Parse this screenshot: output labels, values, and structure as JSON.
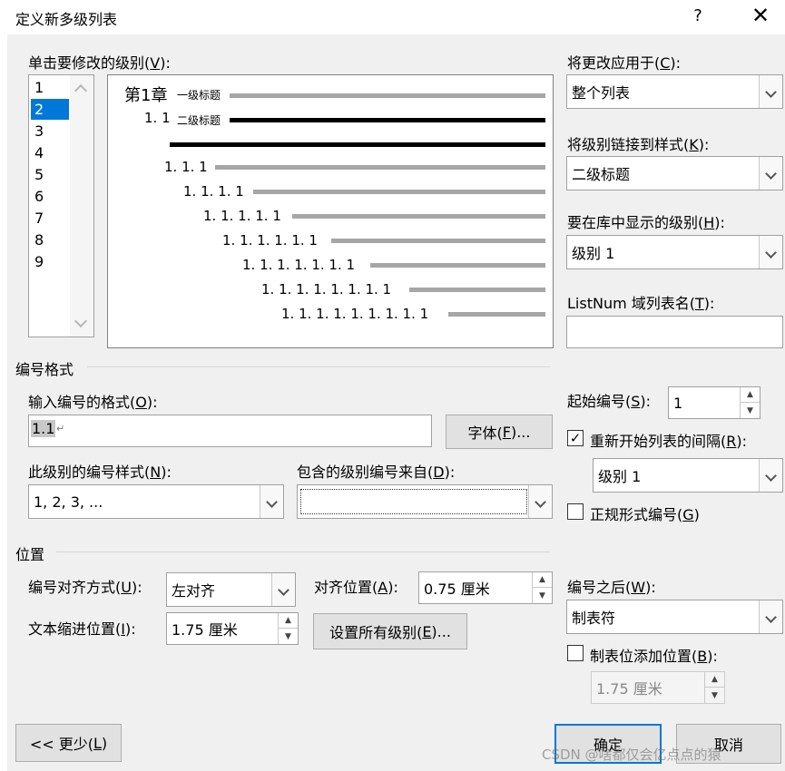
{
  "dialog": {
    "title": "定义新多级列表",
    "help_label": "?",
    "close_label": "✕"
  },
  "levels": {
    "label": "单击要修改的级别(V):",
    "items": [
      "1",
      "2",
      "3",
      "4",
      "5",
      "6",
      "7",
      "8",
      "9"
    ],
    "selected": "2"
  },
  "preview": {
    "l1_prefix": "第1章",
    "l1_title": "一级标题",
    "l2_prefix": "1. 1",
    "l2_title": "二级标题",
    "rows": [
      "1. 1. 1",
      "1. 1. 1. 1",
      "1. 1. 1. 1. 1",
      "1. 1. 1. 1. 1. 1",
      "1. 1. 1. 1. 1. 1. 1",
      "1. 1. 1. 1. 1. 1. 1. 1",
      "1. 1. 1. 1. 1. 1. 1. 1. 1"
    ]
  },
  "right_panel": {
    "apply_to_label": "将更改应用于(C):",
    "apply_to_value": "整个列表",
    "link_style_label": "将级别链接到样式(K):",
    "link_style_value": "二级标题",
    "gallery_level_label": "要在库中显示的级别(H):",
    "gallery_level_value": "级别 1",
    "listnum_label": "ListNum 域列表名(T):",
    "listnum_value": ""
  },
  "number_format": {
    "section_label": "编号格式",
    "format_label": "输入编号的格式(O):",
    "format_value": "1.1",
    "format_mark": "↵",
    "font_button": "字体(F)...",
    "style_label": "此级别的编号样式(N):",
    "style_value": "1, 2, 3, ...",
    "include_label": "包含的级别编号来自(D):",
    "include_value": "",
    "start_at_label": "起始编号(S):",
    "start_at_value": "1",
    "restart_label": "重新开始列表的间隔(R):",
    "restart_checked": true,
    "restart_value": "级别 1",
    "legal_label": "正规形式编号(G)",
    "legal_checked": false
  },
  "position": {
    "section_label": "位置",
    "alignment_label": "编号对齐方式(U):",
    "alignment_value": "左对齐",
    "aligned_at_label": "对齐位置(A):",
    "aligned_at_value": "0.75 厘米",
    "indent_label": "文本缩进位置(I):",
    "indent_value": "1.75 厘米",
    "set_all_button": "设置所有级别(E)...",
    "follow_label": "编号之后(W):",
    "follow_value": "制表符",
    "tab_stop_label": "制表位添加位置(B):",
    "tab_stop_checked": false,
    "tab_stop_value": "1.75 厘米"
  },
  "footer": {
    "less_button": "<< 更少(L)",
    "ok_button": "确定",
    "cancel_button": "取消",
    "watermark": "CSDN @啥都仅会亿点点的猿"
  }
}
